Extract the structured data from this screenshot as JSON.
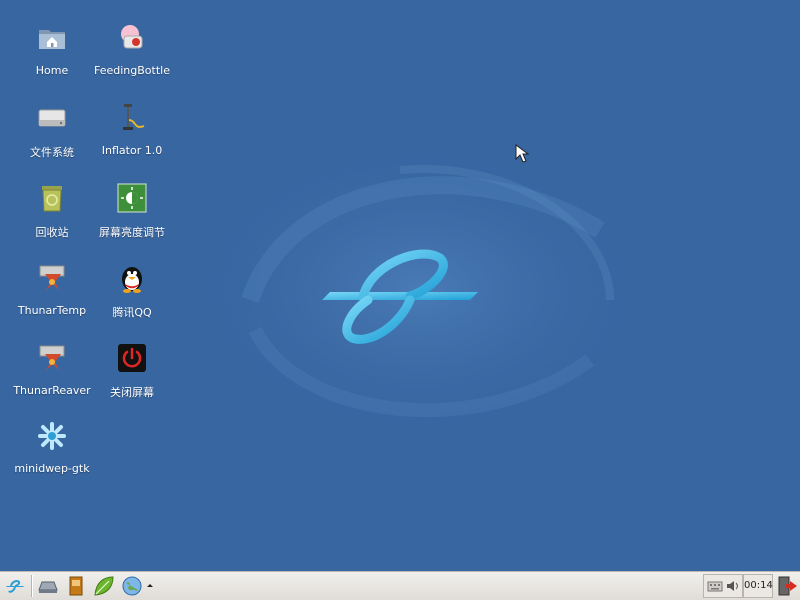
{
  "desktop": {
    "icons": [
      {
        "label": "Home",
        "icon": "home-folder-icon"
      },
      {
        "label": "FeedingBottle",
        "icon": "feeding-bottle-icon"
      },
      {
        "label": "文件系统",
        "icon": "hard-drive-icon"
      },
      {
        "label": "Inflator 1.0",
        "icon": "air-pump-icon"
      },
      {
        "label": "回收站",
        "icon": "trash-can-icon"
      },
      {
        "label": "屏幕亮度调节",
        "icon": "brightness-icon"
      },
      {
        "label": "ThunarTemp",
        "icon": "file-manager-icon"
      },
      {
        "label": "腾讯QQ",
        "icon": "qq-penguin-icon"
      },
      {
        "label": "ThunarReaver",
        "icon": "file-manager-icon"
      },
      {
        "label": "关闭屏幕",
        "icon": "power-icon"
      },
      {
        "label": "minidwep-gtk",
        "icon": "wifi-tool-icon"
      }
    ]
  },
  "taskbar": {
    "launchers": [
      "app-menu-icon",
      "drive-icon",
      "book-icon",
      "leaf-icon",
      "browser-globe-icon",
      "launcher-arrow-icon"
    ],
    "tray": [
      "keyboard-icon",
      "volume-icon"
    ],
    "clock": "00:14",
    "logout": "logout-icon"
  },
  "colors": {
    "desktop_bg": "#3866a1",
    "logo_cyan": "#36b7e6",
    "taskbar_bg": "#e8e5e1"
  }
}
